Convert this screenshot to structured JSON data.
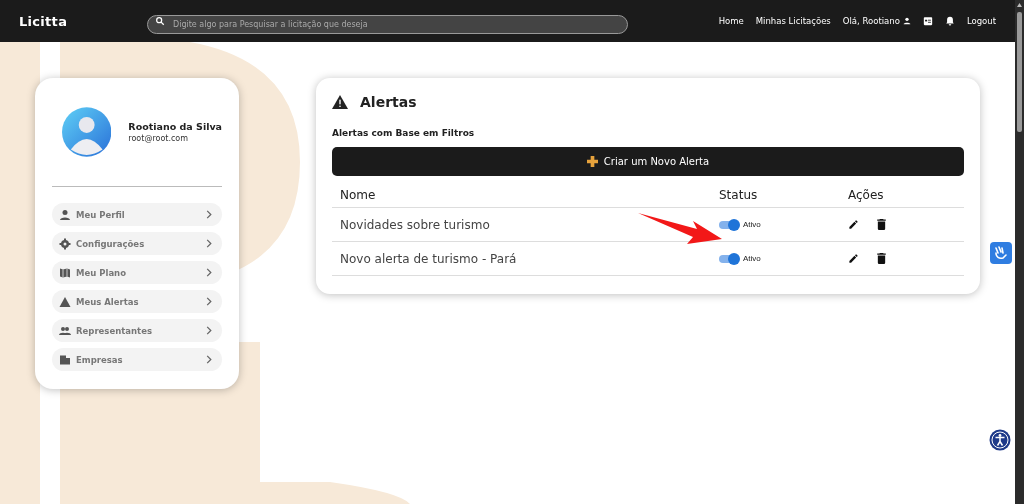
{
  "header": {
    "logo": "Licitta",
    "search": {
      "placeholder": "Digite algo para Pesquisar a licitação que deseja"
    },
    "nav": [
      {
        "kind": "link",
        "label": "Home"
      },
      {
        "kind": "link",
        "label": "Minhas Licitações"
      },
      {
        "kind": "user",
        "label": "Olá, Rootiano"
      },
      {
        "kind": "calendar"
      },
      {
        "kind": "bell"
      },
      {
        "kind": "link",
        "label": "Logout"
      }
    ]
  },
  "profile": {
    "name": "Rootiano da Silva",
    "email": "root@root.com"
  },
  "menu": [
    {
      "kind": "user",
      "label": "Meu Perfil"
    },
    {
      "kind": "gear",
      "label": "Configurações"
    },
    {
      "kind": "map",
      "label": "Meu Plano"
    },
    {
      "kind": "warning",
      "label": "Meus Alertas"
    },
    {
      "kind": "group",
      "label": "Representantes"
    },
    {
      "kind": "building",
      "label": "Empresas"
    }
  ],
  "alerts": {
    "title": "Alertas",
    "subtitle": "Alertas com Base em Filtros",
    "create_button": "Criar um Novo Alerta",
    "columns": [
      "Nome",
      "Status",
      "Ações"
    ],
    "rows": [
      {
        "name": "Novidades sobre turismo",
        "on": true,
        "status": "Ativo"
      },
      {
        "name": "Novo alerta de turismo - Pará",
        "on": true,
        "status": "Ativo"
      }
    ]
  }
}
